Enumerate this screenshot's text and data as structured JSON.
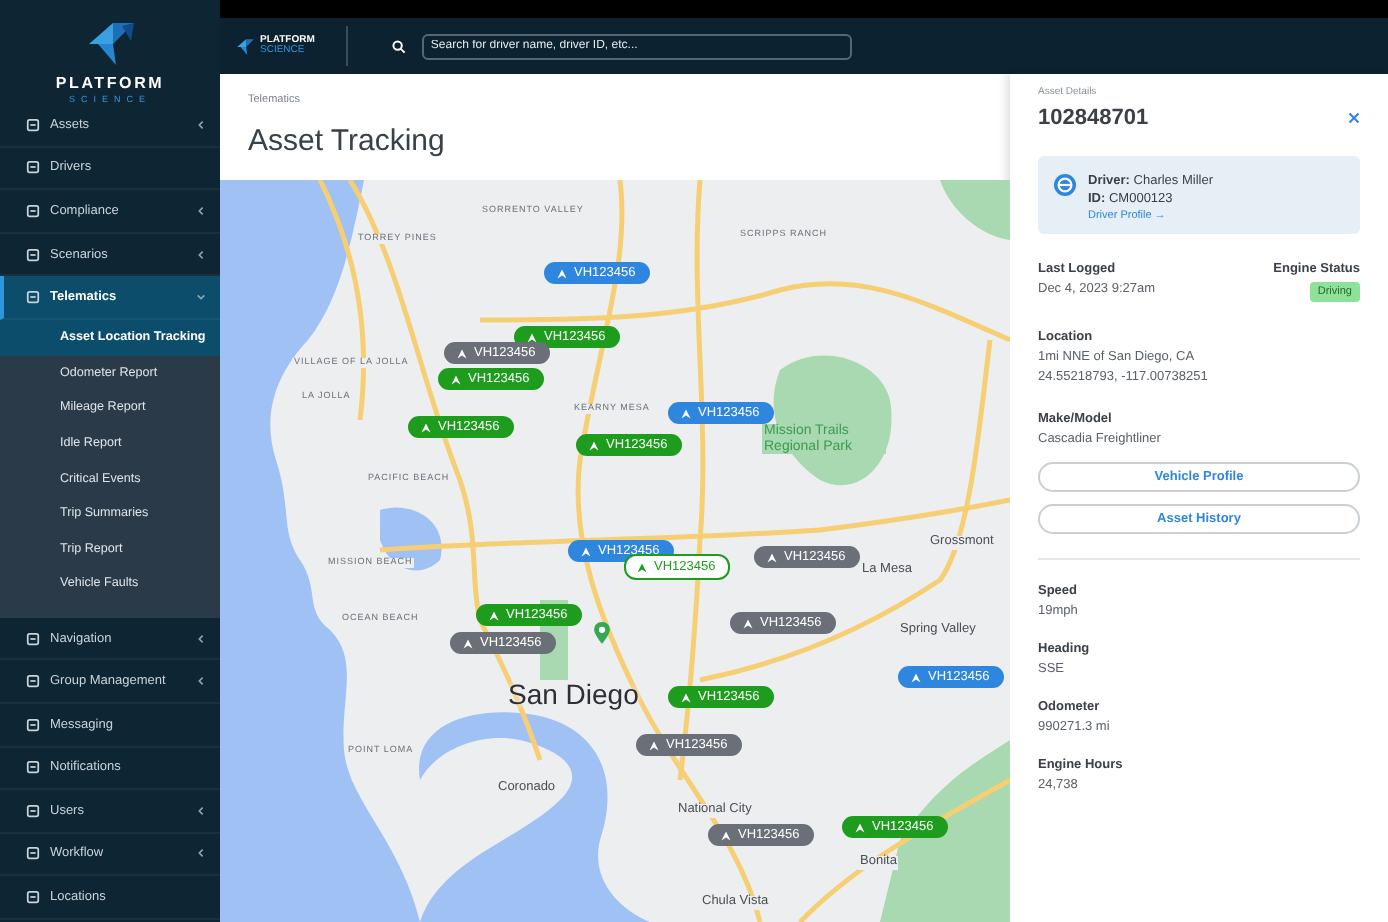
{
  "brand": {
    "name": "PLATFORM",
    "sub": "SCIENCE"
  },
  "sidebar": {
    "items": [
      {
        "label": "Assets",
        "expandable": true,
        "selected": false
      },
      {
        "label": "Drivers",
        "expandable": false,
        "selected": false
      },
      {
        "label": "Compliance",
        "expandable": true,
        "selected": false
      },
      {
        "label": "Scenarios",
        "expandable": true,
        "selected": false
      },
      {
        "label": "Telematics",
        "expandable": true,
        "expanded": true,
        "selected": true,
        "children": [
          {
            "label": "Asset Location Tracking",
            "selected": true
          },
          {
            "label": "Odometer Report",
            "selected": false
          },
          {
            "label": "Mileage Report",
            "selected": false
          },
          {
            "label": "Idle Report",
            "selected": false
          },
          {
            "label": "Critical Events",
            "selected": false
          },
          {
            "label": "Trip Summaries",
            "selected": false
          },
          {
            "label": "Trip Report",
            "selected": false
          },
          {
            "label": "Vehicle Faults",
            "selected": false
          }
        ]
      },
      {
        "label": "Navigation",
        "expandable": true,
        "selected": false
      },
      {
        "label": "Group Management",
        "expandable": true,
        "selected": false
      },
      {
        "label": "Messaging",
        "expandable": false,
        "selected": false
      },
      {
        "label": "Notifications",
        "expandable": false,
        "selected": false
      },
      {
        "label": "Users",
        "expandable": true,
        "selected": false
      },
      {
        "label": "Workflow",
        "expandable": true,
        "selected": false
      },
      {
        "label": "Locations",
        "expandable": false,
        "selected": false
      }
    ]
  },
  "topbar": {
    "brand": {
      "name": "PLATFORM",
      "sub": "SCIENCE"
    },
    "search": {
      "placeholder": "Search for driver name, driver ID, etc..."
    }
  },
  "page": {
    "breadcrumb": "Telematics",
    "title": "Asset Tracking"
  },
  "map": {
    "places": [
      {
        "label": "SORRENTO VALLEY",
        "kind": "district"
      },
      {
        "label": "TORREY PINES",
        "kind": "district"
      },
      {
        "label": "SCRIPPS RANCH",
        "kind": "district"
      },
      {
        "label": "VILLAGE OF LA JOLLA",
        "kind": "district"
      },
      {
        "label": "LA JOLLA",
        "kind": "district"
      },
      {
        "label": "KEARNY MESA",
        "kind": "district"
      },
      {
        "label": "Mission Trails Regional Park",
        "kind": "park"
      },
      {
        "label": "PACIFIC BEACH",
        "kind": "district"
      },
      {
        "label": "MISSION BEACH",
        "kind": "district"
      },
      {
        "label": "Grossmont",
        "kind": "town"
      },
      {
        "label": "La Mesa",
        "kind": "town"
      },
      {
        "label": "OCEAN BEACH",
        "kind": "district"
      },
      {
        "label": "Spring Valley",
        "kind": "town"
      },
      {
        "label": "San Diego",
        "kind": "city"
      },
      {
        "label": "POINT LOMA",
        "kind": "district"
      },
      {
        "label": "Coronado",
        "kind": "town"
      },
      {
        "label": "National City",
        "kind": "town"
      },
      {
        "label": "Bonita",
        "kind": "town"
      },
      {
        "label": "Chula Vista",
        "kind": "town"
      }
    ],
    "markers": [
      {
        "label": "VH123456",
        "color": "#2f86de",
        "selected": false
      },
      {
        "label": "VH123456",
        "color": "#1e9c1e",
        "selected": false
      },
      {
        "label": "VH123456",
        "color": "#6b7078",
        "selected": false
      },
      {
        "label": "VH123456",
        "color": "#1e9c1e",
        "selected": false
      },
      {
        "label": "VH123456",
        "color": "#1e9c1e",
        "selected": false
      },
      {
        "label": "VH123456",
        "color": "#2f86de",
        "selected": false
      },
      {
        "label": "VH123456",
        "color": "#1e9c1e",
        "selected": false
      },
      {
        "label": "VH123456",
        "color": "#2f86de",
        "selected": false
      },
      {
        "label": "VH123456",
        "color": "#1e9c1e",
        "selected": true
      },
      {
        "label": "VH123456",
        "color": "#6b7078",
        "selected": false
      },
      {
        "label": "VH123456",
        "color": "#1e9c1e",
        "selected": false
      },
      {
        "label": "VH123456",
        "color": "#6b7078",
        "selected": false
      },
      {
        "label": "VH123456",
        "color": "#6b7078",
        "selected": false
      },
      {
        "label": "VH123456",
        "color": "#2f86de",
        "selected": false
      },
      {
        "label": "VH123456",
        "color": "#1e9c1e",
        "selected": false
      },
      {
        "label": "VH123456",
        "color": "#6b7078",
        "selected": false
      },
      {
        "label": "VH123456",
        "color": "#6b7078",
        "selected": false
      },
      {
        "label": "VH123456",
        "color": "#1e9c1e",
        "selected": false
      }
    ]
  },
  "details": {
    "caption": "Asset Details",
    "asset_id": "102848701",
    "driver": {
      "name_line": "**Driver:** Charles Miller",
      "id_line": "**ID:** CM000123",
      "link": "Driver Profile →"
    },
    "last_logged": {
      "label": "Last Logged",
      "value": "Dec 4, 2023 9:27am"
    },
    "engine_status": {
      "label": "Engine Status",
      "badge": "Driving"
    },
    "location": {
      "label": "Location",
      "lines": [
        "1mi NNE of San Diego, CA",
        "24.55218793, -117.00738251"
      ]
    },
    "make_model": {
      "label": "Make/Model",
      "value": "Cascadia Freightliner"
    },
    "buttons": [
      "Vehicle Profile",
      "Asset History"
    ],
    "stats": [
      {
        "label": "Speed",
        "value": "19mph"
      },
      {
        "label": "Heading",
        "value": "SSE"
      },
      {
        "label": "Odometer",
        "value": "990271.3 mi"
      },
      {
        "label": "Engine Hours",
        "value": "24,738"
      }
    ]
  }
}
